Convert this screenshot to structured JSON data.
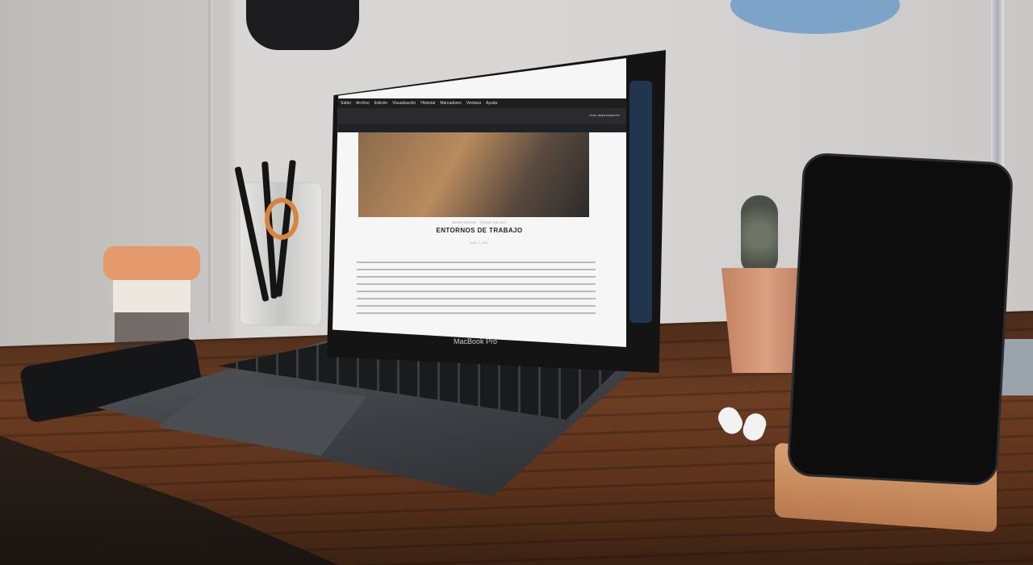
{
  "screen": {
    "menubar_items": [
      "Safari",
      "Archivo",
      "Edición",
      "Visualización",
      "Historial",
      "Marcadores",
      "Ventana",
      "Ayuda"
    ],
    "post_category": "WORKSPACE · ROMO EN DIC",
    "post_title": "ENTORNOS DE TRABAJO",
    "post_date": "junio 7, 2021",
    "greeting": "Hola, alejandrojsurez"
  },
  "laptop_label": "MacBook Pro"
}
